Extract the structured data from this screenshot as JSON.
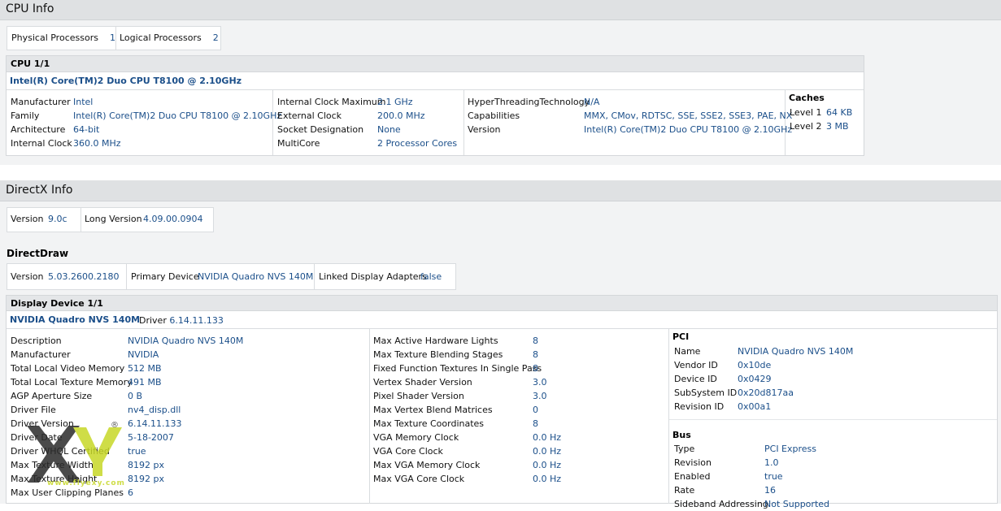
{
  "cpu_info": {
    "title": "CPU Info",
    "summary": [
      {
        "label": "Physical Processors",
        "value": "1"
      },
      {
        "label": "Logical Processors",
        "value": "2"
      }
    ],
    "cpu_header": "CPU 1/1",
    "cpu_name": "Intel(R) Core(TM)2 Duo CPU T8100 @ 2.10GHz",
    "col1": [
      {
        "label": "Manufacturer",
        "value": "Intel"
      },
      {
        "label": "Family",
        "value": "Intel(R) Core(TM)2 Duo CPU T8100 @ 2.10GHz"
      },
      {
        "label": "Architecture",
        "value": "64-bit"
      },
      {
        "label": "Internal Clock",
        "value": "360.0 MHz"
      }
    ],
    "col2": [
      {
        "label": "Internal Clock Maximum",
        "value": "2.1 GHz"
      },
      {
        "label": "External Clock",
        "value": "200.0 MHz"
      },
      {
        "label": "Socket Designation",
        "value": "None"
      },
      {
        "label": "MultiCore",
        "value": "2 Processor Cores"
      }
    ],
    "col3": [
      {
        "label": "HyperThreadingTechnology",
        "value": "N/A"
      },
      {
        "label": "Capabilities",
        "value": "MMX, CMov, RDTSC, SSE, SSE2, SSE3, PAE, NX"
      },
      {
        "label": "Version",
        "value": "Intel(R) Core(TM)2 Duo CPU T8100 @ 2.10GHz"
      }
    ],
    "caches": {
      "title": "Caches",
      "items": [
        {
          "label": "Level 1",
          "value": "64 KB"
        },
        {
          "label": "Level 2",
          "value": "3 MB"
        }
      ]
    }
  },
  "directx_info": {
    "title": "DirectX Info",
    "summary": [
      {
        "label": "Version",
        "value": "9.0c"
      },
      {
        "label": "Long Version",
        "value": "4.09.00.0904"
      }
    ],
    "directdraw": {
      "title": "DirectDraw",
      "summary": [
        {
          "label": "Version",
          "value": "5.03.2600.2180"
        },
        {
          "label": "Primary Device",
          "value": "NVIDIA Quadro NVS 140M"
        },
        {
          "label": "Linked Display Adapters",
          "value": "false"
        }
      ]
    },
    "display_device": {
      "header": "Display Device 1/1",
      "name": "NVIDIA Quadro NVS 140M",
      "driver_label": "Driver",
      "driver_value": "6.14.11.133",
      "col1": [
        {
          "label": "Description",
          "value": "NVIDIA Quadro NVS 140M"
        },
        {
          "label": "Manufacturer",
          "value": "NVIDIA"
        },
        {
          "label": "Total Local Video Memory",
          "value": "512 MB"
        },
        {
          "label": "Total Local Texture Memory",
          "value": "491 MB"
        },
        {
          "label": "AGP Aperture Size",
          "value": "0 B"
        },
        {
          "label": "Driver File",
          "value": "nv4_disp.dll"
        },
        {
          "label": "Driver Version",
          "value": "6.14.11.133"
        },
        {
          "label": "Driver Date",
          "value": "5-18-2007"
        },
        {
          "label": "Driver WHQL Certified",
          "value": "true"
        },
        {
          "label": "Max Texture Width",
          "value": "8192 px"
        },
        {
          "label": "Max Texture Height",
          "value": "8192 px"
        },
        {
          "label": "Max User Clipping Planes",
          "value": "6"
        }
      ],
      "col2": [
        {
          "label": "Max Active Hardware Lights",
          "value": "8"
        },
        {
          "label": "Max Texture Blending Stages",
          "value": "8"
        },
        {
          "label": "Fixed Function Textures In Single Pass",
          "value": "8"
        },
        {
          "label": "Vertex Shader Version",
          "value": "3.0"
        },
        {
          "label": "Pixel Shader Version",
          "value": "3.0"
        },
        {
          "label": "Max Vertex Blend Matrices",
          "value": "0"
        },
        {
          "label": "Max Texture Coordinates",
          "value": "8"
        },
        {
          "label": "VGA Memory Clock",
          "value": "0.0 Hz"
        },
        {
          "label": "VGA Core Clock",
          "value": "0.0 Hz"
        },
        {
          "label": "Max VGA Memory Clock",
          "value": "0.0 Hz"
        },
        {
          "label": "Max VGA Core Clock",
          "value": "0.0 Hz"
        }
      ],
      "pci": {
        "title": "PCI",
        "items": [
          {
            "label": "Name",
            "value": "NVIDIA Quadro NVS 140M"
          },
          {
            "label": "Vendor ID",
            "value": "0x10de"
          },
          {
            "label": "Device ID",
            "value": "0x0429"
          },
          {
            "label": "SubSystem ID",
            "value": "0x20d817aa"
          },
          {
            "label": "Revision ID",
            "value": "0x00a1"
          }
        ]
      },
      "bus": {
        "title": "Bus",
        "items": [
          {
            "label": "Type",
            "value": "PCI Express"
          },
          {
            "label": "Revision",
            "value": "1.0"
          },
          {
            "label": "Enabled",
            "value": "true"
          },
          {
            "label": "Rate",
            "value": "16"
          },
          {
            "label": "Sideband Addressing",
            "value": "Not Supported"
          }
        ]
      }
    }
  },
  "watermark": {
    "text": "www.flyexy.com",
    "registered": "®",
    "colors": {
      "x": "#2b2b2b",
      "y": "#c7d827"
    }
  },
  "colors": {
    "value_link": "#1b4f8a",
    "section_bar": "#dfe1e3"
  }
}
